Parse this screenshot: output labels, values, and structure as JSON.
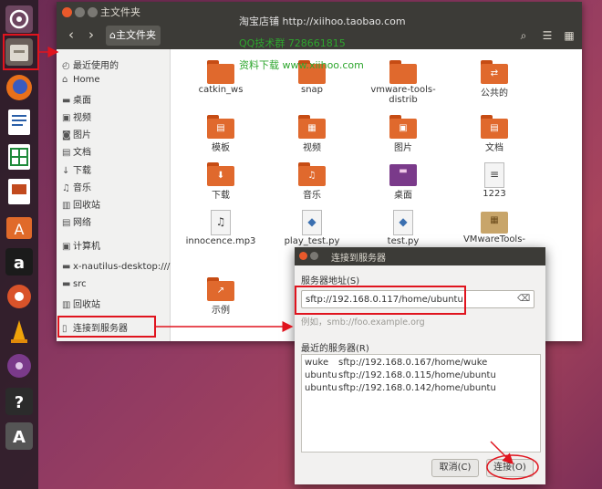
{
  "launcher": {
    "items": [
      {
        "name": "ubuntu-dash-icon"
      },
      {
        "name": "files-icon"
      },
      {
        "name": "firefox-icon"
      },
      {
        "name": "writer-icon"
      },
      {
        "name": "calc-icon"
      },
      {
        "name": "impress-icon"
      },
      {
        "name": "software-center-icon"
      },
      {
        "name": "amazon-icon",
        "glyph": "a"
      },
      {
        "name": "system-settings-icon"
      },
      {
        "name": "vlc-icon"
      },
      {
        "name": "disc-icon"
      },
      {
        "name": "terminal-icon",
        "glyph": "?"
      },
      {
        "name": "updater-icon",
        "glyph": "A"
      }
    ]
  },
  "file_manager": {
    "title": "主文件夹",
    "path_button": "⌂主文件夹",
    "sidebar": [
      {
        "icon": "◴",
        "label": "最近使用的"
      },
      {
        "icon": "⌂",
        "label": "Home"
      },
      {
        "icon": "▬",
        "label": "桌面"
      },
      {
        "icon": "▣",
        "label": "视频"
      },
      {
        "icon": "◙",
        "label": "图片"
      },
      {
        "icon": "▤",
        "label": "文档"
      },
      {
        "icon": "↓",
        "label": "下载"
      },
      {
        "icon": "♫",
        "label": "音乐"
      },
      {
        "icon": "▥",
        "label": "回收站"
      },
      {
        "icon": "▤",
        "label": "网络"
      },
      {
        "icon": "▣",
        "label": "计算机"
      },
      {
        "icon": "▬",
        "label": "x-nautilus-desktop:///"
      },
      {
        "icon": "▬",
        "label": "src"
      },
      {
        "icon": "▥",
        "label": "回收站"
      },
      {
        "icon": "▯",
        "label": "连接到服务器"
      }
    ],
    "files": [
      {
        "label": "catkin_ws",
        "kind": "folder"
      },
      {
        "label": "snap",
        "kind": "folder"
      },
      {
        "label": "vmware-tools-distrib",
        "kind": "folder"
      },
      {
        "label": "公共的",
        "kind": "folder",
        "emblem": "⇄"
      },
      {
        "label": "模板",
        "kind": "folder",
        "emblem": "▤"
      },
      {
        "label": "视频",
        "kind": "folder",
        "emblem": "▦"
      },
      {
        "label": "图片",
        "kind": "folder",
        "emblem": "▣"
      },
      {
        "label": "文档",
        "kind": "folder",
        "emblem": "▤"
      },
      {
        "label": "下载",
        "kind": "folder",
        "emblem": "⬇"
      },
      {
        "label": "音乐",
        "kind": "folder",
        "emblem": "♫"
      },
      {
        "label": "桌面",
        "kind": "desktop"
      },
      {
        "label": "1223",
        "kind": "text"
      },
      {
        "label": "innocence.mp3",
        "kind": "mp3"
      },
      {
        "label": "play_test.py",
        "kind": "py"
      },
      {
        "label": "test.py",
        "kind": "py"
      },
      {
        "label": "VMwareTools-",
        "kind": "archive"
      },
      {
        "label": "示例",
        "kind": "folder",
        "emblem": "↗"
      }
    ]
  },
  "dialog": {
    "title": "连接到服务器",
    "server_label": "服务器地址(S)",
    "server_value": "sftp://192.168.0.117/home/ubuntu",
    "example": "例如，smb://foo.example.org",
    "recent_label": "最近的服务器(R)",
    "recent": [
      {
        "user": "wuke",
        "url": "sftp://192.168.0.167/home/wuke"
      },
      {
        "user": "ubuntu",
        "url": "sftp://192.168.0.115/home/ubuntu"
      },
      {
        "user": "ubuntu",
        "url": "sftp://192.168.0.142/home/ubuntu"
      }
    ],
    "cancel": "取消(C)",
    "connect": "连接(O)"
  },
  "watermark": {
    "line1": "淘宝店铺  http://xiihoo.taobao.com",
    "line2": "QQ技术群  728661815",
    "line3": "资料下载  www.xiihoo.com"
  },
  "colors": {
    "accent": "#e0692d",
    "highlight": "#e0141e",
    "watermark": "#2ea62e"
  }
}
